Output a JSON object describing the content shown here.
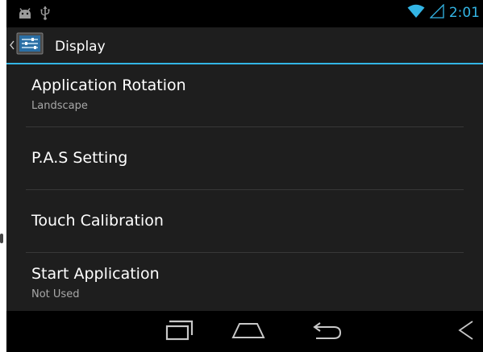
{
  "status_bar": {
    "time": "2:01",
    "left_icons": [
      "android-debug-icon",
      "usb-icon"
    ],
    "right_icons": [
      "wifi-icon",
      "signal-icon"
    ]
  },
  "action_bar": {
    "title": "Display",
    "icon": "display-settings-icon"
  },
  "settings": [
    {
      "title": "Application Rotation",
      "summary": "Landscape"
    },
    {
      "title": "P.A.S Setting"
    },
    {
      "title": "Touch Calibration"
    },
    {
      "title": "Start Application",
      "summary": "Not Used"
    }
  ],
  "nav_bar": {
    "buttons": [
      "recent-apps-icon",
      "home-icon",
      "back-icon",
      "menu-triangle-icon"
    ]
  },
  "colors": {
    "accent": "#33b5e5",
    "background": "#1e1e1e",
    "bars": "#000000",
    "primary_text": "#ffffff",
    "secondary_text": "#a8a8a8"
  }
}
